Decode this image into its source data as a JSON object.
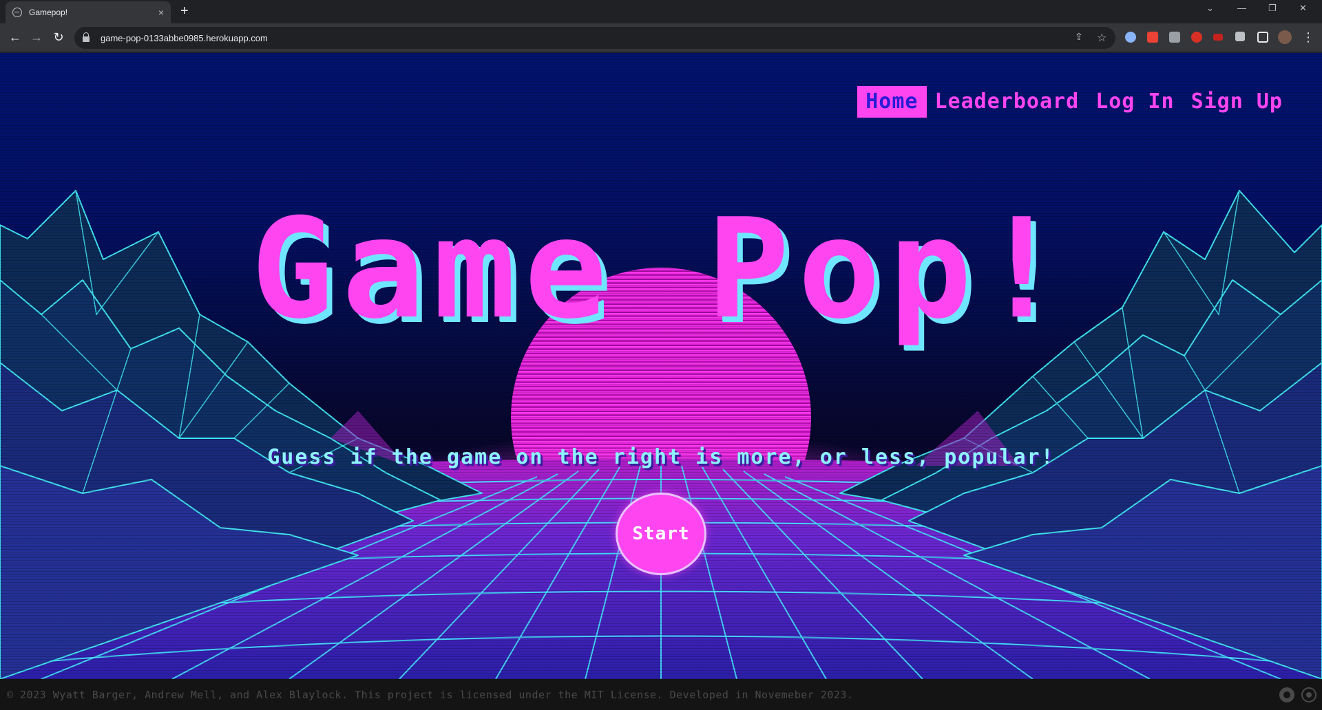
{
  "browser": {
    "tab_title": "Gamepop!",
    "tab_close": "×",
    "new_tab": "+",
    "url": "game-pop-0133abbe0985.herokuapp.com",
    "back": "←",
    "forward": "→",
    "reload": "↻",
    "window_controls": {
      "dropdown": "⌄",
      "minimize": "—",
      "restore": "❐",
      "close": "✕"
    },
    "omni_share": "⇪",
    "omni_star": "☆",
    "menu": "⋮"
  },
  "nav": {
    "items": [
      {
        "label": "Home",
        "active": true
      },
      {
        "label": "Leaderboard",
        "active": false
      },
      {
        "label": "Log In",
        "active": false
      },
      {
        "label": "Sign Up",
        "active": false
      }
    ]
  },
  "hero": {
    "title": "Game Pop!",
    "subtitle": "Guess if the game on the right is more, or less, popular!",
    "start_label": "Start"
  },
  "footer": {
    "copyright": "© 2023 Wyatt Barger, Andrew Mell, and Alex Blaylock. This project is licensed under the MIT License. Developed in Novemeber 2023."
  },
  "colors": {
    "accent_pink": "#ff45f0",
    "accent_cyan": "#6fe6ff",
    "nav_active_text": "#2a1bd6",
    "sky_top": "#02136e"
  }
}
